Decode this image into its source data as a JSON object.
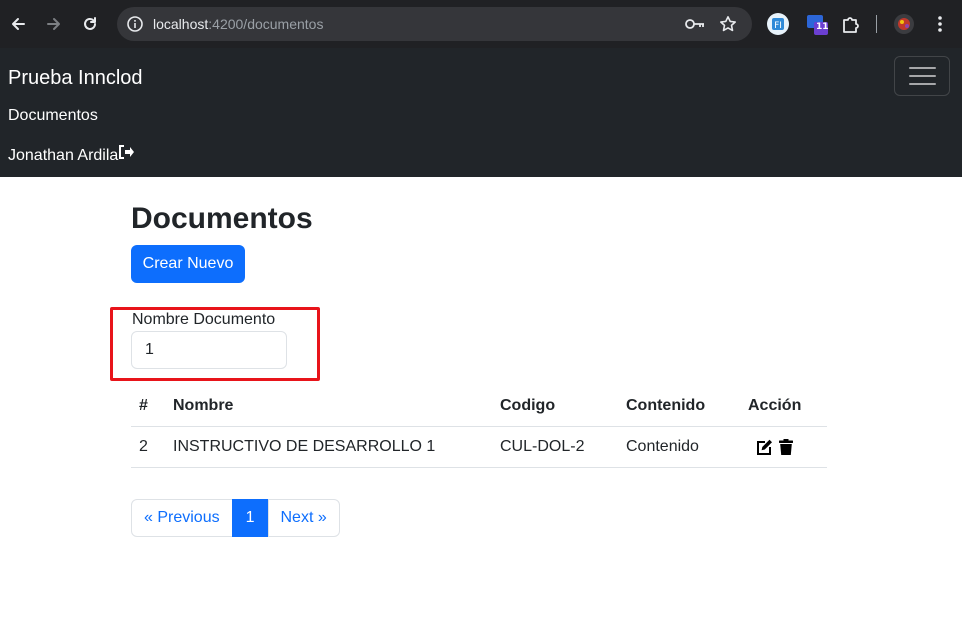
{
  "browser": {
    "url_host": "localhost",
    "url_path": ":4200/documentos",
    "extension_badge": "11"
  },
  "navbar": {
    "brand": "Prueba Innclod",
    "documents_link": "Documentos",
    "user_name": "Jonathan Ardila"
  },
  "main": {
    "title": "Documentos",
    "create_button": "Crear Nuevo",
    "filter": {
      "label": "Nombre Documento",
      "value": "1"
    },
    "table": {
      "headers": [
        "#",
        "Nombre",
        "Codigo",
        "Contenido",
        "Acción"
      ],
      "rows": [
        {
          "id": "2",
          "nombre": "INSTRUCTIVO DE DESARROLLO 1",
          "codigo": "CUL-DOL-2",
          "contenido": "Contenido"
        }
      ]
    },
    "pagination": {
      "previous": "« Previous",
      "current": "1",
      "next": "Next »"
    }
  },
  "colors": {
    "primary": "#0d6efd",
    "navbar_bg": "#212529",
    "highlight": "#e8141a"
  }
}
